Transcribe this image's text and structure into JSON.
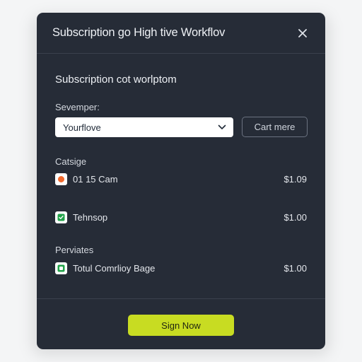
{
  "dialog": {
    "title": "Subscription go High tive Workflov",
    "section_title": "Subscription cot worlptom",
    "field_label": "Sevemper:",
    "select_value": "Yourflove",
    "cart_button": "Cart mere",
    "groups": [
      {
        "label": "Catsige",
        "items": [
          {
            "icon": "orange-dot-icon",
            "name": "01 15 Cam",
            "price": "$1.09"
          },
          {
            "icon": "green-check-icon",
            "name": "Tehnsop",
            "price": "$1.00"
          }
        ]
      },
      {
        "label": "Perviates",
        "items": [
          {
            "icon": "green-badge-icon",
            "name": "Totul Comrlioy Bage",
            "price": "$1.00"
          }
        ]
      }
    ],
    "primary_button": "Sign Now"
  },
  "colors": {
    "dialog_bg": "#262c37",
    "accent": "#c8dc22",
    "icon_orange": "#f26a2e",
    "icon_green": "#22a34a"
  }
}
